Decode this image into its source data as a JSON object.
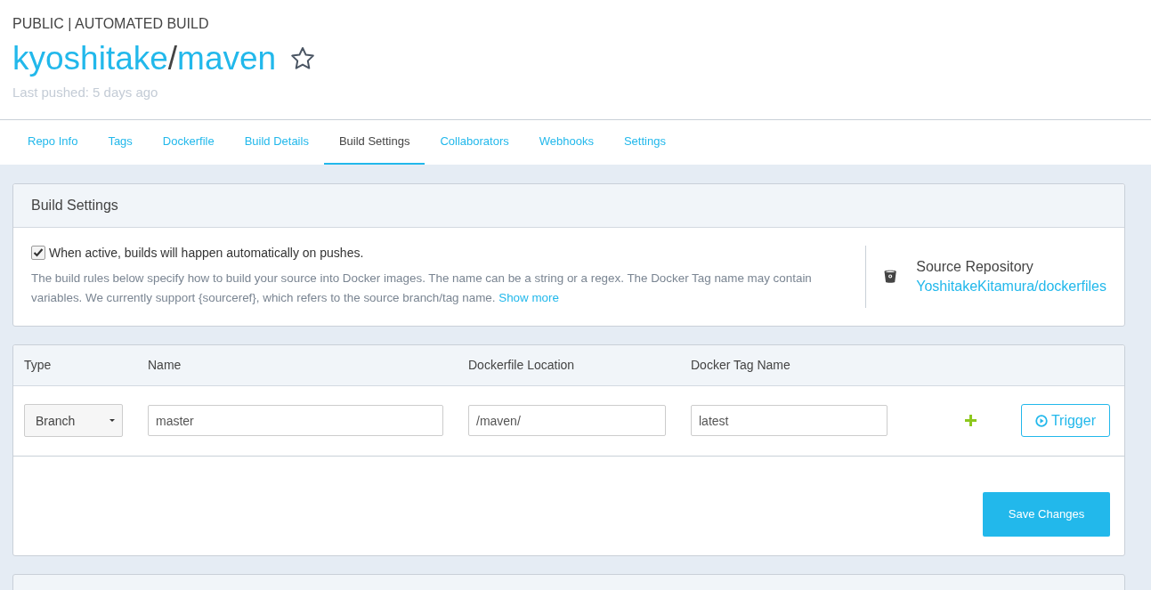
{
  "header": {
    "visibility": "PUBLIC | AUTOMATED BUILD",
    "owner": "kyoshitake",
    "separator": "/",
    "repo": "maven",
    "last_pushed": "Last pushed: 5 days ago"
  },
  "tabs": [
    {
      "label": "Repo Info",
      "selected": false
    },
    {
      "label": "Tags",
      "selected": false
    },
    {
      "label": "Dockerfile",
      "selected": false
    },
    {
      "label": "Build Details",
      "selected": false
    },
    {
      "label": "Build Settings",
      "selected": true
    },
    {
      "label": "Collaborators",
      "selected": false
    },
    {
      "label": "Webhooks",
      "selected": false
    },
    {
      "label": "Settings",
      "selected": false
    }
  ],
  "build_settings": {
    "title": "Build Settings",
    "auto_build": {
      "checked": true,
      "label": "When active, builds will happen automatically on pushes."
    },
    "description": "The build rules below specify how to build your source into Docker images. The name can be a string or a regex. The Docker Tag name may contain variables. We currently support {sourceref}, which refers to the source branch/tag name.",
    "show_more": "Show more",
    "source_repository": {
      "label": "Source Repository",
      "value": "YoshitakeKitamura/dockerfiles"
    }
  },
  "rules": {
    "columns": [
      "Type",
      "Name",
      "Dockerfile Location",
      "Docker Tag Name"
    ],
    "rows": [
      {
        "type": "Branch",
        "name": "master",
        "dockerfile_location": "/maven/",
        "docker_tag_name": "latest",
        "trigger": "Trigger"
      }
    ],
    "save": "Save Changes"
  }
}
